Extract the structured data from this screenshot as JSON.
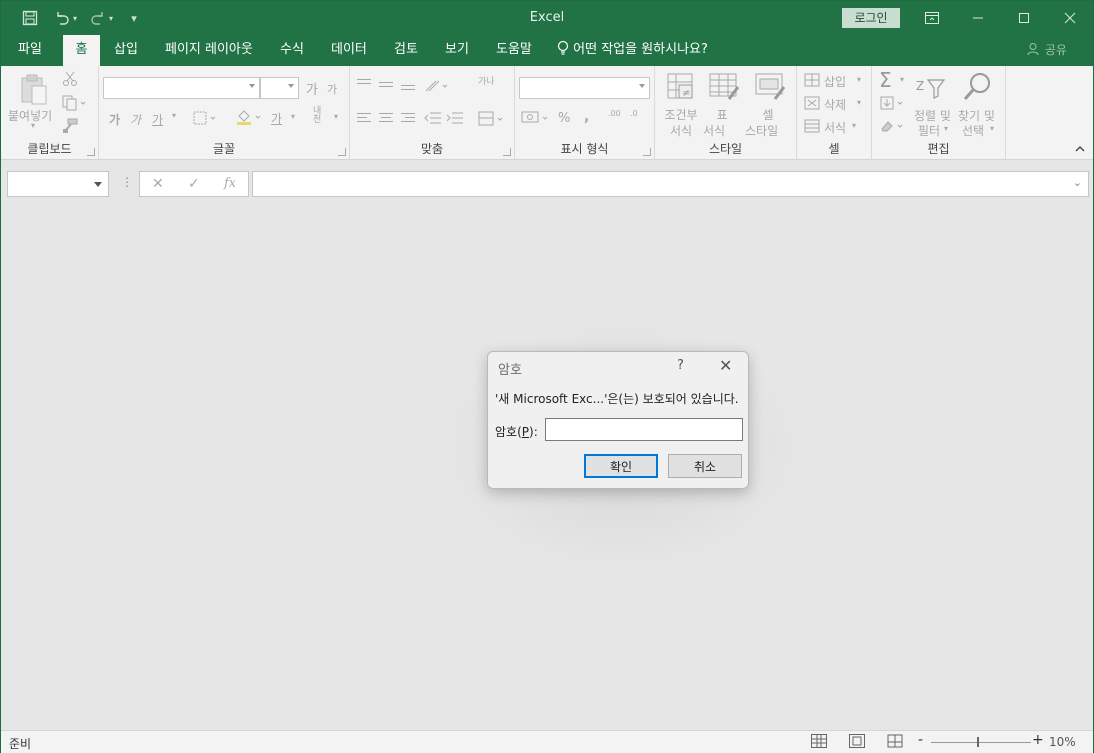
{
  "app": {
    "title": "Excel",
    "login_label": "로그인"
  },
  "window_controls": {
    "restore_ribbon_icon": "ribbon-display-icon",
    "minimize_icon": "minimize-icon",
    "maximize_icon": "maximize-icon",
    "close_icon": "close-icon"
  },
  "quick_access": {
    "save_icon": "save-icon",
    "undo_icon": "undo-icon",
    "redo_icon": "redo-icon",
    "customize_icon": "customize-qat-icon"
  },
  "tabs": [
    "파일",
    "홈",
    "삽입",
    "페이지 레이아웃",
    "수식",
    "데이터",
    "검토",
    "보기",
    "도움말"
  ],
  "active_tab": "홈",
  "tell_me": "어떤 작업을 원하시나요?",
  "share_label": "공유",
  "ribbon": {
    "clipboard": {
      "label": "클립보드",
      "paste_label": "붙여넣기"
    },
    "font": {
      "label": "글꼴",
      "bold": "가",
      "italic": "가",
      "underline": "가",
      "grow": "가",
      "shrink": "가",
      "color_a": "가",
      "phonetic": "내천"
    },
    "alignment": {
      "label": "맞춤",
      "wrap": "가나"
    },
    "number": {
      "label": "표시 형식",
      "percent": "%",
      "comma": ",",
      "inc_decimal": ".00",
      "dec_decimal": ".0"
    },
    "styles": {
      "label": "스타일",
      "conditional": "조건부",
      "conditional2": "서식",
      "table": "표",
      "table2": "서식",
      "cell": "셀",
      "cell2": "스타일"
    },
    "cells": {
      "label": "셀",
      "insert": "삽입",
      "delete": "삭제",
      "format": "서식"
    },
    "editing": {
      "label": "편집",
      "sort": "정렬 및",
      "sort2": "필터",
      "find": "찾기 및",
      "find2": "선택"
    }
  },
  "formula_bar": {
    "cancel_icon": "✕",
    "enter_icon": "✓",
    "fx_label": "fx",
    "name_box_value": "",
    "formula_value": ""
  },
  "status": {
    "ready": "준비",
    "zoom_minus": "-",
    "zoom_plus": "+",
    "zoom_level": "10%",
    "zoom_fraction": 0.46
  },
  "dialog": {
    "title": "암호",
    "help": "?",
    "close": "✕",
    "message": "'새 Microsoft Exc...'은(는) 보호되어 있습니다.",
    "password_label_pre": "암호(",
    "password_label_key": "P",
    "password_label_post": "):",
    "password_value": "",
    "ok_label": "확인",
    "cancel_label": "취소"
  }
}
